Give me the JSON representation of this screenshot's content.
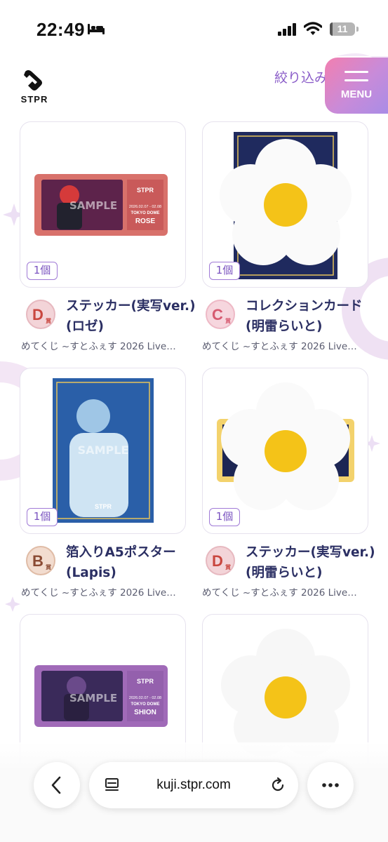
{
  "status_bar": {
    "time": "22:49",
    "battery": "11",
    "battery_level": 0.11
  },
  "header": {
    "logo_text": "STPR",
    "filter_label": "絞り込み",
    "menu_label": "MENU"
  },
  "items": [
    {
      "title": "ステッカー(実写ver.)(ロゼ)",
      "subtitle": "めてくじ ~すとふぇす 2026 Live…",
      "quantity": "1個",
      "rank_letter": "D",
      "rank_suffix": "賞",
      "image": "sticker-ticket-red",
      "image_label": "SAMPLE",
      "ticket_name": "ROSE"
    },
    {
      "title": "コレクションカード(明雷らいと)",
      "subtitle": "めてくじ ~すとふぇす 2026 Live…",
      "quantity": "1個",
      "rank_letter": "C",
      "rank_suffix": "賞",
      "image": "collection-card-covered",
      "image_label": "",
      "ticket_name": ""
    },
    {
      "title": "箔入りA5ポスター(Lapis)",
      "subtitle": "めてくじ ~すとふぇす 2026 Live…",
      "quantity": "1個",
      "rank_letter": "B",
      "rank_suffix": "賞",
      "image": "poster-blue",
      "image_label": "SAMPLE",
      "ticket_name": ""
    },
    {
      "title": "ステッカー(実写ver.)(明雷らいと)",
      "subtitle": "めてくじ ~すとふぇす 2026 Live…",
      "quantity": "1個",
      "rank_letter": "D",
      "rank_suffix": "賞",
      "image": "sticker-covered",
      "image_label": "",
      "ticket_name": ""
    },
    {
      "title": "",
      "subtitle": "",
      "quantity": "",
      "image": "sticker-ticket-purple",
      "image_label": "SAMPLE",
      "ticket_name": "SHION"
    },
    {
      "title": "",
      "subtitle": "",
      "quantity": "",
      "image": "flower-covered",
      "image_label": "",
      "ticket_name": ""
    }
  ],
  "ticket_common": {
    "venue": "TOKYO DOME",
    "dates": "2026.02.07 - 02.08"
  },
  "browser": {
    "url": "kuji.stpr.com"
  },
  "colors": {
    "accent_purple": "#8a5cc8",
    "title_navy": "#2b2f63",
    "menu_gradient_start": "#f27fb0",
    "menu_gradient_end": "#a98ce6",
    "rank_d": "#c9473f",
    "rank_c": "#d65a70",
    "rank_b": "#8a4a33"
  }
}
